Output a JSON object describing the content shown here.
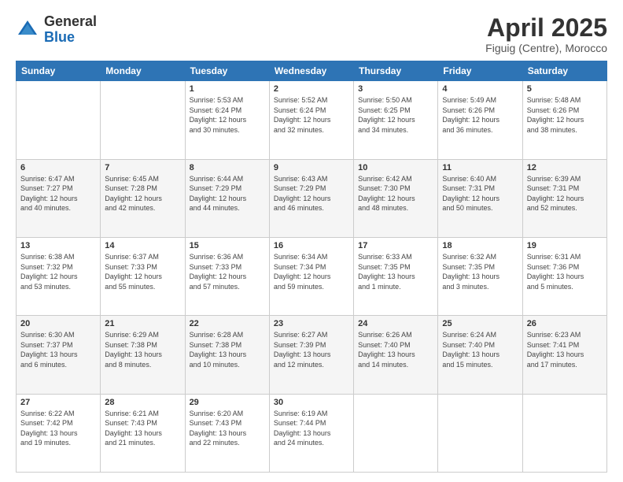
{
  "logo": {
    "general": "General",
    "blue": "Blue"
  },
  "header": {
    "title": "April 2025",
    "location": "Figuig (Centre), Morocco"
  },
  "weekdays": [
    "Sunday",
    "Monday",
    "Tuesday",
    "Wednesday",
    "Thursday",
    "Friday",
    "Saturday"
  ],
  "weeks": [
    [
      {
        "day": "",
        "info": ""
      },
      {
        "day": "",
        "info": ""
      },
      {
        "day": "1",
        "info": "Sunrise: 5:53 AM\nSunset: 6:24 PM\nDaylight: 12 hours\nand 30 minutes."
      },
      {
        "day": "2",
        "info": "Sunrise: 5:52 AM\nSunset: 6:24 PM\nDaylight: 12 hours\nand 32 minutes."
      },
      {
        "day": "3",
        "info": "Sunrise: 5:50 AM\nSunset: 6:25 PM\nDaylight: 12 hours\nand 34 minutes."
      },
      {
        "day": "4",
        "info": "Sunrise: 5:49 AM\nSunset: 6:26 PM\nDaylight: 12 hours\nand 36 minutes."
      },
      {
        "day": "5",
        "info": "Sunrise: 5:48 AM\nSunset: 6:26 PM\nDaylight: 12 hours\nand 38 minutes."
      }
    ],
    [
      {
        "day": "6",
        "info": "Sunrise: 6:47 AM\nSunset: 7:27 PM\nDaylight: 12 hours\nand 40 minutes."
      },
      {
        "day": "7",
        "info": "Sunrise: 6:45 AM\nSunset: 7:28 PM\nDaylight: 12 hours\nand 42 minutes."
      },
      {
        "day": "8",
        "info": "Sunrise: 6:44 AM\nSunset: 7:29 PM\nDaylight: 12 hours\nand 44 minutes."
      },
      {
        "day": "9",
        "info": "Sunrise: 6:43 AM\nSunset: 7:29 PM\nDaylight: 12 hours\nand 46 minutes."
      },
      {
        "day": "10",
        "info": "Sunrise: 6:42 AM\nSunset: 7:30 PM\nDaylight: 12 hours\nand 48 minutes."
      },
      {
        "day": "11",
        "info": "Sunrise: 6:40 AM\nSunset: 7:31 PM\nDaylight: 12 hours\nand 50 minutes."
      },
      {
        "day": "12",
        "info": "Sunrise: 6:39 AM\nSunset: 7:31 PM\nDaylight: 12 hours\nand 52 minutes."
      }
    ],
    [
      {
        "day": "13",
        "info": "Sunrise: 6:38 AM\nSunset: 7:32 PM\nDaylight: 12 hours\nand 53 minutes."
      },
      {
        "day": "14",
        "info": "Sunrise: 6:37 AM\nSunset: 7:33 PM\nDaylight: 12 hours\nand 55 minutes."
      },
      {
        "day": "15",
        "info": "Sunrise: 6:36 AM\nSunset: 7:33 PM\nDaylight: 12 hours\nand 57 minutes."
      },
      {
        "day": "16",
        "info": "Sunrise: 6:34 AM\nSunset: 7:34 PM\nDaylight: 12 hours\nand 59 minutes."
      },
      {
        "day": "17",
        "info": "Sunrise: 6:33 AM\nSunset: 7:35 PM\nDaylight: 13 hours\nand 1 minute."
      },
      {
        "day": "18",
        "info": "Sunrise: 6:32 AM\nSunset: 7:35 PM\nDaylight: 13 hours\nand 3 minutes."
      },
      {
        "day": "19",
        "info": "Sunrise: 6:31 AM\nSunset: 7:36 PM\nDaylight: 13 hours\nand 5 minutes."
      }
    ],
    [
      {
        "day": "20",
        "info": "Sunrise: 6:30 AM\nSunset: 7:37 PM\nDaylight: 13 hours\nand 6 minutes."
      },
      {
        "day": "21",
        "info": "Sunrise: 6:29 AM\nSunset: 7:38 PM\nDaylight: 13 hours\nand 8 minutes."
      },
      {
        "day": "22",
        "info": "Sunrise: 6:28 AM\nSunset: 7:38 PM\nDaylight: 13 hours\nand 10 minutes."
      },
      {
        "day": "23",
        "info": "Sunrise: 6:27 AM\nSunset: 7:39 PM\nDaylight: 13 hours\nand 12 minutes."
      },
      {
        "day": "24",
        "info": "Sunrise: 6:26 AM\nSunset: 7:40 PM\nDaylight: 13 hours\nand 14 minutes."
      },
      {
        "day": "25",
        "info": "Sunrise: 6:24 AM\nSunset: 7:40 PM\nDaylight: 13 hours\nand 15 minutes."
      },
      {
        "day": "26",
        "info": "Sunrise: 6:23 AM\nSunset: 7:41 PM\nDaylight: 13 hours\nand 17 minutes."
      }
    ],
    [
      {
        "day": "27",
        "info": "Sunrise: 6:22 AM\nSunset: 7:42 PM\nDaylight: 13 hours\nand 19 minutes."
      },
      {
        "day": "28",
        "info": "Sunrise: 6:21 AM\nSunset: 7:43 PM\nDaylight: 13 hours\nand 21 minutes."
      },
      {
        "day": "29",
        "info": "Sunrise: 6:20 AM\nSunset: 7:43 PM\nDaylight: 13 hours\nand 22 minutes."
      },
      {
        "day": "30",
        "info": "Sunrise: 6:19 AM\nSunset: 7:44 PM\nDaylight: 13 hours\nand 24 minutes."
      },
      {
        "day": "",
        "info": ""
      },
      {
        "day": "",
        "info": ""
      },
      {
        "day": "",
        "info": ""
      }
    ]
  ]
}
